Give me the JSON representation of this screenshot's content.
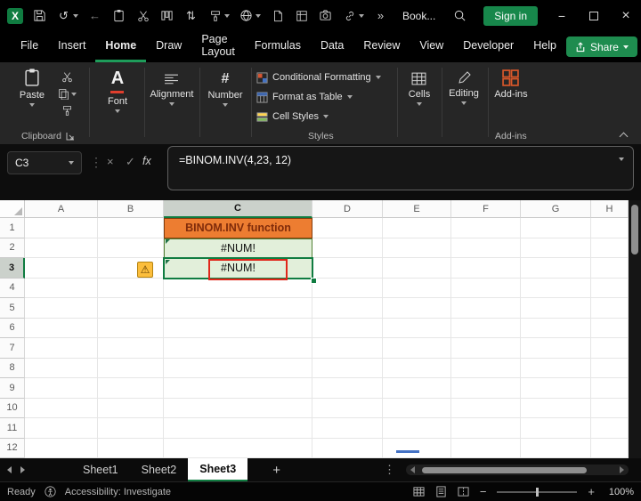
{
  "titlebar": {
    "workbook_name": "Book...",
    "signin_label": "Sign in"
  },
  "menubar": {
    "items": [
      "File",
      "Insert",
      "Home",
      "Draw",
      "Page Layout",
      "Formulas",
      "Data",
      "Review",
      "View",
      "Developer",
      "Help"
    ],
    "active_item": "Home",
    "share_label": "Share"
  },
  "ribbon": {
    "paste": "Paste",
    "font": "Font",
    "alignment": "Alignment",
    "number": "Number",
    "conditional_formatting": "Conditional Formatting",
    "format_as_table": "Format as Table",
    "cell_styles": "Cell Styles",
    "cells": "Cells",
    "editing": "Editing",
    "addins_button": "Add-ins",
    "group_clipboard": "Clipboard",
    "group_styles": "Styles",
    "group_addins": "Add-ins"
  },
  "formula_bar": {
    "name_box": "C3",
    "formula": "=BINOM.INV(4,23, 12)"
  },
  "grid": {
    "columns": [
      "A",
      "B",
      "C",
      "D",
      "E",
      "F",
      "G",
      "H"
    ],
    "rows": [
      "1",
      "2",
      "3",
      "4",
      "5",
      "6",
      "7",
      "8",
      "9",
      "10",
      "11",
      "12"
    ],
    "selected_column": "C",
    "selected_row": "3",
    "cells": {
      "c1": "BINOM.INV function",
      "c2": "#NUM!",
      "c3": "#NUM!"
    }
  },
  "sheet_tabs": {
    "tabs": [
      "Sheet1",
      "Sheet2",
      "Sheet3"
    ],
    "active_tab": "Sheet3"
  },
  "status_bar": {
    "mode": "Ready",
    "accessibility": "Accessibility: Investigate",
    "zoom": "100%"
  },
  "icons": {
    "excel_logo": "X",
    "undo": "↺",
    "back": "←",
    "sort": "⇅",
    "more": "»",
    "dots": "⋮",
    "cancel": "×",
    "confirm": "✓",
    "fx": "fx",
    "warning": "⚠",
    "plus": "+",
    "minimize": "−",
    "close": "×",
    "number_group": "#",
    "font_glyph": "A"
  },
  "colors": {
    "accent_green": "#107C41",
    "header_orange": "#ED7D31",
    "cell_green_fill": "#E2EFDA",
    "error_red": "#E0261A"
  }
}
